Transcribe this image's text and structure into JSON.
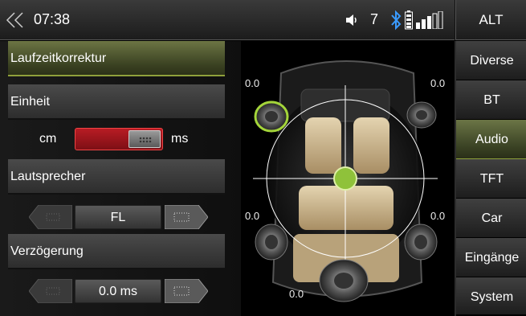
{
  "topbar": {
    "time": "07:38",
    "volume": "7",
    "alt_label": "ALT",
    "icons": [
      "back-chevron-icon",
      "speaker-volume-icon",
      "bluetooth-icon",
      "battery-icon",
      "signal-bars-icon"
    ]
  },
  "panel": {
    "laufzeit_label": "Laufzeitkorrektur",
    "einheit_label": "Einheit",
    "unit_left": "cm",
    "unit_right": "ms",
    "lautsprecher_label": "Lautsprecher",
    "speaker_value": "FL",
    "verzoegerung_label": "Verzögerung",
    "delay_value": "0.0 ms"
  },
  "speakers": {
    "front_left": "0.0",
    "front_right": "0.0",
    "rear_left": "0.0",
    "rear_right": "0.0",
    "sub": "0.0"
  },
  "menu": {
    "items": [
      {
        "label": "Diverse"
      },
      {
        "label": "BT"
      },
      {
        "label": "Audio"
      },
      {
        "label": "TFT"
      },
      {
        "label": "Car"
      },
      {
        "label": "Eingänge"
      },
      {
        "label": "System"
      }
    ]
  },
  "colors": {
    "accent_green": "#8fc23a",
    "toggle_red": "#b81c24"
  }
}
